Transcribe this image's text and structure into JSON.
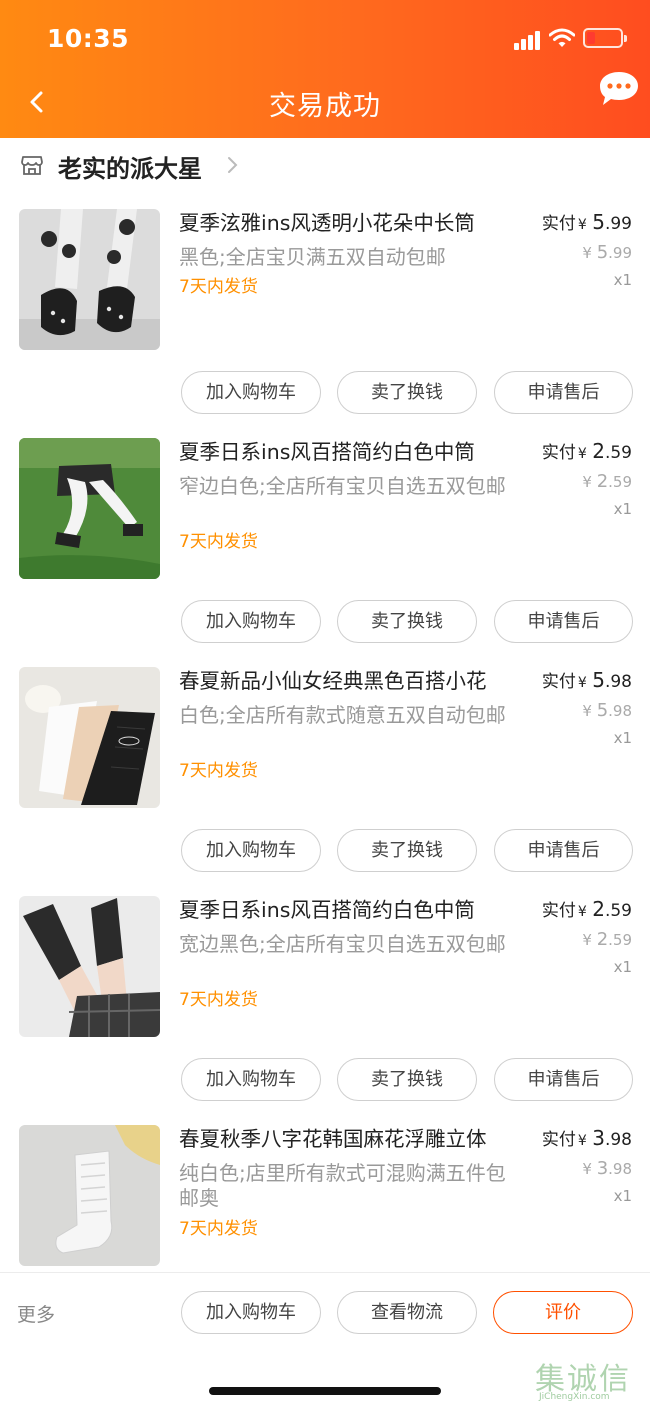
{
  "status_bar": {
    "time": "10:35"
  },
  "nav": {
    "title": "交易成功"
  },
  "shop": {
    "name": "老实的派大星"
  },
  "items": [
    {
      "title": "夏季泫雅ins风透明小花朵中长筒",
      "sku": "黑色;全店宝贝满五双自动包邮",
      "ship": "7天内发货",
      "paid_label": "实付",
      "currency": "¥",
      "paid_int": "5",
      "paid_dec": ".99",
      "orig_int": "5",
      "orig_dec": ".99",
      "qty": "x1"
    },
    {
      "title": "夏季日系ins风百搭简约白色中筒",
      "sku": "窄边白色;全店所有宝贝自选五双包邮",
      "ship": "7天内发货",
      "paid_label": "实付",
      "currency": "¥",
      "paid_int": "2",
      "paid_dec": ".59",
      "orig_int": "2",
      "orig_dec": ".59",
      "qty": "x1"
    },
    {
      "title": "春夏新品小仙女经典黑色百搭小花",
      "sku": "白色;全店所有款式随意五双自动包邮",
      "ship": "7天内发货",
      "paid_label": "实付",
      "currency": "¥",
      "paid_int": "5",
      "paid_dec": ".98",
      "orig_int": "5",
      "orig_dec": ".98",
      "qty": "x1"
    },
    {
      "title": "夏季日系ins风百搭简约白色中筒",
      "sku": "宽边黑色;全店所有宝贝自选五双包邮",
      "ship": "7天内发货",
      "paid_label": "实付",
      "currency": "¥",
      "paid_int": "2",
      "paid_dec": ".59",
      "orig_int": "2",
      "orig_dec": ".59",
      "qty": "x1"
    },
    {
      "title": "春夏秋季八字花韩国麻花浮雕立体",
      "sku": "纯白色;店里所有款式可混购满五件包邮奥",
      "ship": "7天内发货",
      "paid_label": "实付",
      "currency": "¥",
      "paid_int": "3",
      "paid_dec": ".98",
      "orig_int": "3",
      "orig_dec": ".98",
      "qty": "x1"
    }
  ],
  "item_actions": {
    "add_cart": "加入购物车",
    "sell": "卖了换钱",
    "after_sale": "申请售后"
  },
  "bottom_bar": {
    "more": "更多",
    "add_cart": "加入购物车",
    "logistics": "查看物流",
    "review": "评价"
  },
  "watermark": {
    "cn": "集诚信",
    "en": "JiChengXin.com"
  },
  "colors": {
    "header_start": "#ff8a12",
    "header_end": "#ff4d1f",
    "ship_text": "#ff9000",
    "review_accent": "#ff5000"
  }
}
